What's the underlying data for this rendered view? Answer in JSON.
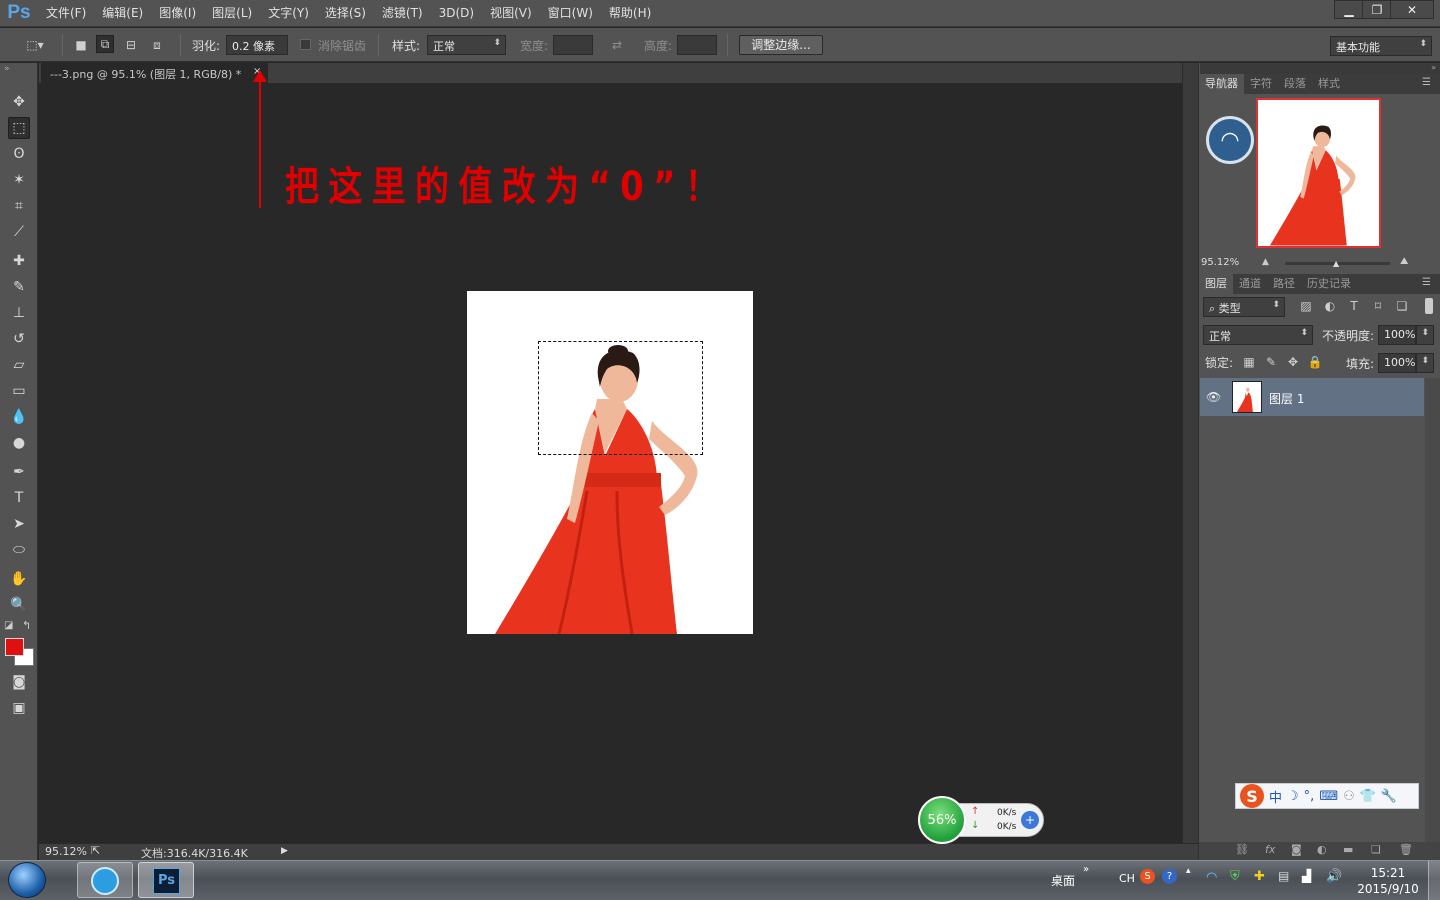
{
  "app": {
    "logo": "Ps",
    "menu": [
      "文件(F)",
      "编辑(E)",
      "图像(I)",
      "图层(L)",
      "文字(Y)",
      "选择(S)",
      "滤镜(T)",
      "3D(D)",
      "视图(V)",
      "窗口(W)",
      "帮助(H)"
    ],
    "window_controls": [
      "minimize-icon",
      "restore-icon",
      "close-icon"
    ]
  },
  "options": {
    "feather_label": "羽化:",
    "feather_value": "0.2 像素",
    "antialias_label": "消除锯齿",
    "style_label": "样式:",
    "style_value": "正常",
    "width_label": "宽度:",
    "height_label": "高度:",
    "refine_edge": "调整边缘...",
    "workspace": "基本功能"
  },
  "document": {
    "tab_title": "---3.png @ 95.1% (图层 1, RGB/8) *",
    "zoom_status": "95.12%",
    "doc_size": "文档:316.4K/316.4K"
  },
  "annotation": {
    "text": "把这里的值改为“0”！",
    "color": "#e10000"
  },
  "panels": {
    "top_tabs": [
      "导航器",
      "字符",
      "段落",
      "样式"
    ],
    "navigator_zoom": "95.12%",
    "layer_tabs": [
      "图层",
      "通道",
      "路径",
      "历史记录"
    ],
    "filter_kind": "类型",
    "blend_mode": "正常",
    "opacity_label": "不透明度:",
    "opacity_value": "100%",
    "lock_label": "锁定:",
    "fill_label": "填充:",
    "fill_value": "100%",
    "layers": [
      {
        "name": "图层 1",
        "visible": true,
        "selected": true
      }
    ]
  },
  "widgets": {
    "net_percent": "56%",
    "upload_speed": "0K/s",
    "download_speed": "0K/s",
    "ime_chars": [
      "中",
      "☽",
      "°,",
      "⌨",
      "👕",
      "🔧"
    ]
  },
  "taskbar": {
    "desktop_label": "桌面",
    "lang": "CH",
    "time": "15:21",
    "date": "2015/9/10"
  },
  "colors": {
    "foreground": "#e01010",
    "background": "#ffffff",
    "dress": "#e8331f"
  }
}
